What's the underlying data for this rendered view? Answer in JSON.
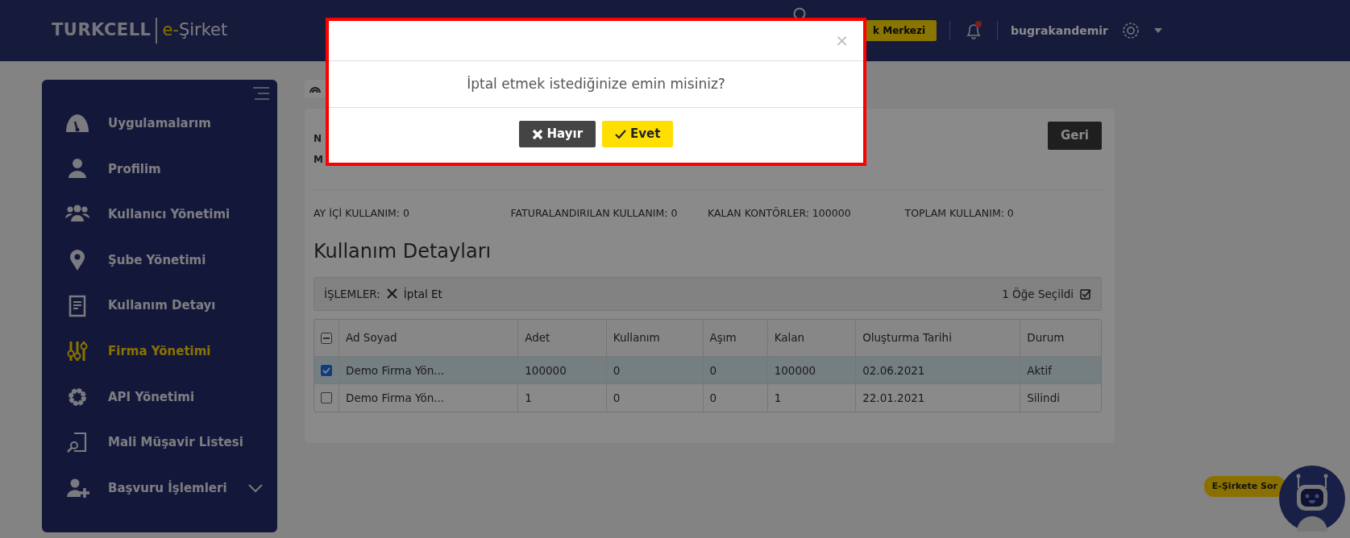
{
  "header": {
    "logo_brand": "TURKCELL",
    "logo_prefix": "e-",
    "logo_product": "Şirket",
    "support_button": "k Merkezi",
    "username": "bugrakandemir"
  },
  "sidebar": {
    "items": [
      {
        "label": "Uygulamalarım",
        "selected": false
      },
      {
        "label": "Profilim",
        "selected": false
      },
      {
        "label": "Kullanıcı Yönetimi",
        "selected": false
      },
      {
        "label": "Şube Yönetimi",
        "selected": false
      },
      {
        "label": "Kullanım Detayı",
        "selected": false
      },
      {
        "label": "Firma Yönetimi",
        "selected": true
      },
      {
        "label": "API Yönetimi",
        "selected": false
      },
      {
        "label": "Mali Müşavir Listesi",
        "selected": false
      },
      {
        "label": "Başvuru İşlemleri",
        "selected": false,
        "expanded": false
      }
    ]
  },
  "card": {
    "cut_lines": [
      "N",
      "M"
    ],
    "back_button": "Geri",
    "stats": [
      {
        "label": "AY İÇİ KULLANIM: 0"
      },
      {
        "label": "FATURALANDIRILAN KULLANIM: 0"
      },
      {
        "label": "KALAN KONTÖRLER: 100000"
      },
      {
        "label": "TOPLAM KULLANIM: 0"
      }
    ],
    "section_title": "Kullanım Detayları",
    "toolbar": {
      "label": "İŞLEMLER:",
      "action": "İptal Et",
      "selection_count": "1 Öğe Seçildi"
    },
    "table": {
      "header_checkbox_partial": true,
      "columns": [
        "Ad Soyad",
        "Adet",
        "Kullanım",
        "Aşım",
        "Kalan",
        "Oluşturma Tarihi",
        "Durum"
      ],
      "rows": [
        {
          "selected": true,
          "cells": [
            "Demo Firma Yön...",
            "100000",
            "0",
            "0",
            "100000",
            "02.06.2021",
            "Aktif"
          ]
        },
        {
          "selected": false,
          "cells": [
            "Demo Firma Yön...",
            "1",
            "0",
            "0",
            "1",
            "22.01.2021",
            "Silindi"
          ]
        }
      ]
    }
  },
  "modal": {
    "close": "×",
    "message": "İptal etmek istediğinize emin misiniz?",
    "buttons": [
      {
        "label": "Hayır",
        "kind": "cancel"
      },
      {
        "label": "Evet",
        "kind": "confirm"
      }
    ]
  },
  "chat_bot": {
    "bubble": "E-Şirkete Sor"
  }
}
